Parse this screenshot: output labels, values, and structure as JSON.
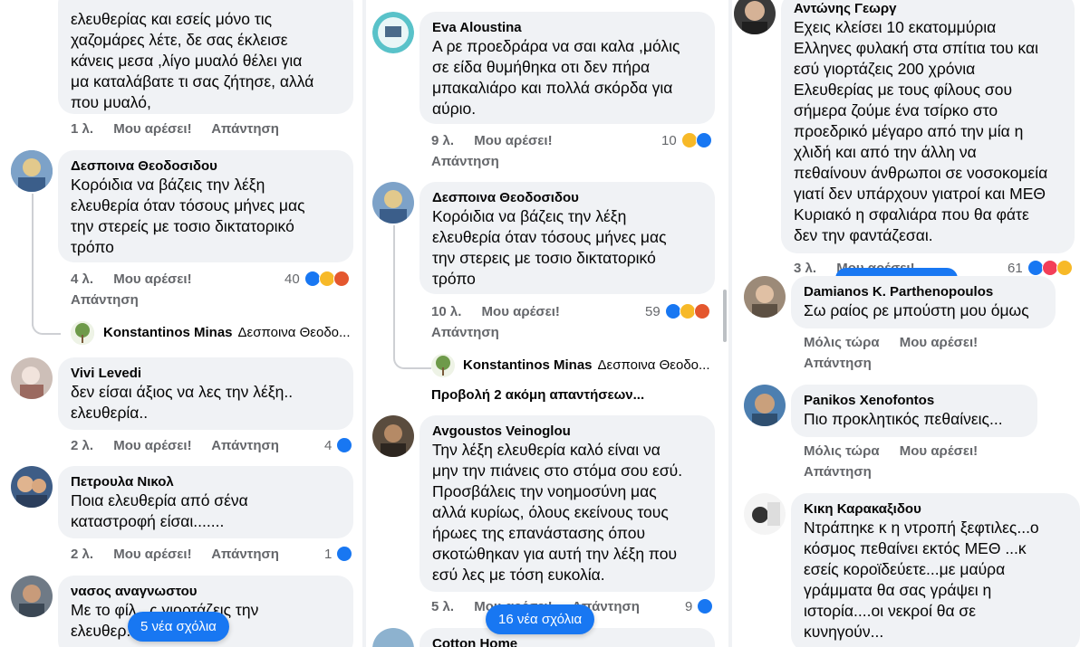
{
  "actions": {
    "like": "Μου αρέσει!",
    "reply": "Απάντηση"
  },
  "panel1": {
    "top_comment": {
      "text": "ελευθερίας και εσείς μόνο τις\nχαζομάρες λέτε, δε σας έκλεισε\nκάνεις μεσα ,λίγο μυαλό θέλει για\nμα καταλάβατε τι σας ζήτησε, αλλά\nπου μυαλό,",
      "time": "1 λ."
    },
    "comments": [
      {
        "name": "Δεσποινα Θεοδοσιδου",
        "text": "Κορόιδια να βάζεις την λέξη\nελευθερία όταν τόσους μήνες μας\nτην στερείς με τοσιο δικτατορικό\nτρόπο",
        "time": "4 λ.",
        "count": "40"
      },
      {
        "name": "Vivi Levedi",
        "text": "δεν είσαι άξιος να λες την λέξη..\nελευθερία..",
        "time": "2 λ.",
        "count": "4"
      },
      {
        "name": "Πετρουλα Νικολ",
        "text": "Ποια ελευθερία από σένα\nκαταστροφή είσαι.......",
        "time": "2 λ.",
        "count": "1"
      },
      {
        "name": "νασος αναγνωστου",
        "text": "Με το φίλ...ς γιορτάζεις την\nελευθερ..."
      }
    ],
    "subreply": {
      "name": "Konstantinos Minas",
      "preview": "Δεσποινα Θεοδο..."
    },
    "new_comments": "5 νέα σχόλια"
  },
  "panel2": {
    "comments": [
      {
        "name": "Eva Aloustina",
        "text": "Α ρε προεδράρα να σαι καλα ,μόλις\nσε είδα θυμήθηκα οτι δεν πήρα\nμπακαλιάρο και πολλά σκόρδα για\nαύριο.",
        "time": "9 λ.",
        "count": "10"
      },
      {
        "name": "Δεσποινα Θεοδοσιδου",
        "text": "Κορόιδια να βάζεις την λέξη\nελευθερία όταν τόσους μήνες μας\nτην στερεις με τοσιο δικτατορικό\nτρόπο",
        "time": "10 λ.",
        "count": "59"
      },
      {
        "name": "Avgoustos Veinoglou",
        "text": "Την λέξη ελευθερία καλό είναι να\nμην την πιάνεις στο στόμα σου εσύ.\nΠροσβάλεις την νοημοσύνη μας\nαλλά κυρίως, όλους εκείνους τους\nήρωες της επανάστασης όπου\nσκοτώθηκαν για αυτή την λέξη που\nεσύ λες με τόση ευκολία.",
        "time": "5 λ.",
        "count": "9"
      },
      {
        "name": "Cotton Home"
      }
    ],
    "subreply": {
      "name": "Konstantinos Minas",
      "preview": "Δεσποινα Θεοδο..."
    },
    "view_more": "Προβολή 2 ακόμη απαντήσεων...",
    "new_comments": "16 νέα σχόλια"
  },
  "panel3": {
    "comments": [
      {
        "name": "Αντώνης Γεωργ",
        "text": "Εχεις κλείσει 10 εκατομμύρια\nΕλληνες φυλακή στα σπίτια του και\nεσύ γιορτάζεις 200 χρόνια\nΕλευθερίας με τους φίλους σου\nσήμερα ζούμε ένα τσίρκο στο\nπροεδρικό μέγαρο από την μία η\nχλιδή και από την άλλη να\nπεθαίνουν άνθρωποι σε νοσοκομεία\nγιατί δεν υπάρχουν γιατροί και ΜΕΘ\nΚυριακό η σφαλιάρα που θα φάτε\nδεν την φαντάζεσαι.",
        "time": "3 λ.",
        "count": "61"
      },
      {
        "name": "Damianos K. Parthenopoulos",
        "text": "Σω ραίος ρε μπούστη μου όμως",
        "time": "Μόλις τώρα"
      },
      {
        "name": "Panikos Xenofontos",
        "text": "Πιο προκλητικός πεθαίνεις...",
        "time": "Μόλις τώρα"
      },
      {
        "name": "Κικη Καρακαξιδου",
        "text": "Ντράπηκε κ η ντροπή ξεφτιλες...ο\nκόσμος πεθαίνει εκτός ΜΕΘ ...κ\nεσείς κοροϊδεύετε...με μαύρα\nγράμματα θα σας γράψει η\nιστορία....οι νεκροί θα σε\nκυνηγούν..."
      }
    ]
  },
  "colors": {
    "bubble": "#f0f2f5",
    "accent": "#1877f2",
    "muted": "#65676b"
  }
}
